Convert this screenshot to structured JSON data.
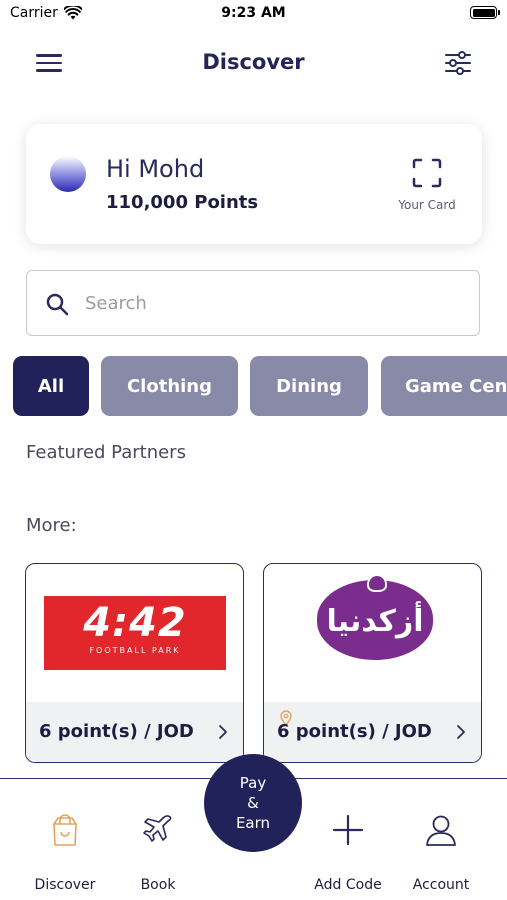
{
  "status_bar": {
    "carrier": "Carrier",
    "time": "9:23 AM",
    "battery_level": 1.0
  },
  "header": {
    "title": "Discover",
    "menu_icon": "hamburger-menu-icon",
    "filter_icon": "sliders-filter-icon"
  },
  "user_card": {
    "greeting": "Hi Mohd",
    "points": "110,000 Points",
    "card_label": "Your Card",
    "card_icon": "scan-frame-icon"
  },
  "search": {
    "placeholder": "Search",
    "value": "",
    "icon": "search-icon"
  },
  "categories": [
    {
      "label": "All",
      "active": true
    },
    {
      "label": "Clothing",
      "active": false
    },
    {
      "label": "Dining",
      "active": false
    },
    {
      "label": "Game Cen",
      "active": false
    }
  ],
  "sections": {
    "featured": "Featured Partners",
    "more": "More:"
  },
  "partners": [
    {
      "logo_title": "4:42",
      "logo_subtitle": "FOOTBALL PARK",
      "rate": "6 point(s) / JOD",
      "has_location": false
    },
    {
      "logo_title": "أزكدنيا",
      "rate": "6 point(s) / JOD",
      "has_location": true
    }
  ],
  "tabs": {
    "discover": {
      "label": "Discover",
      "icon": "shopping-bag-icon"
    },
    "book": {
      "label": "Book",
      "icon": "airplane-icon"
    },
    "pay_earn": {
      "label": "Pay\n&\nEarn"
    },
    "add_code": {
      "label": "Add Code",
      "icon": "plus-icon"
    },
    "account": {
      "label": "Account",
      "icon": "user-icon"
    }
  },
  "colors": {
    "primary": "#22225a",
    "chip_inactive": "#8989a8",
    "accent_orange": "#e8a35a",
    "brand_442_red": "#e1262c",
    "brand_arabic_purple": "#7a2d8c"
  }
}
